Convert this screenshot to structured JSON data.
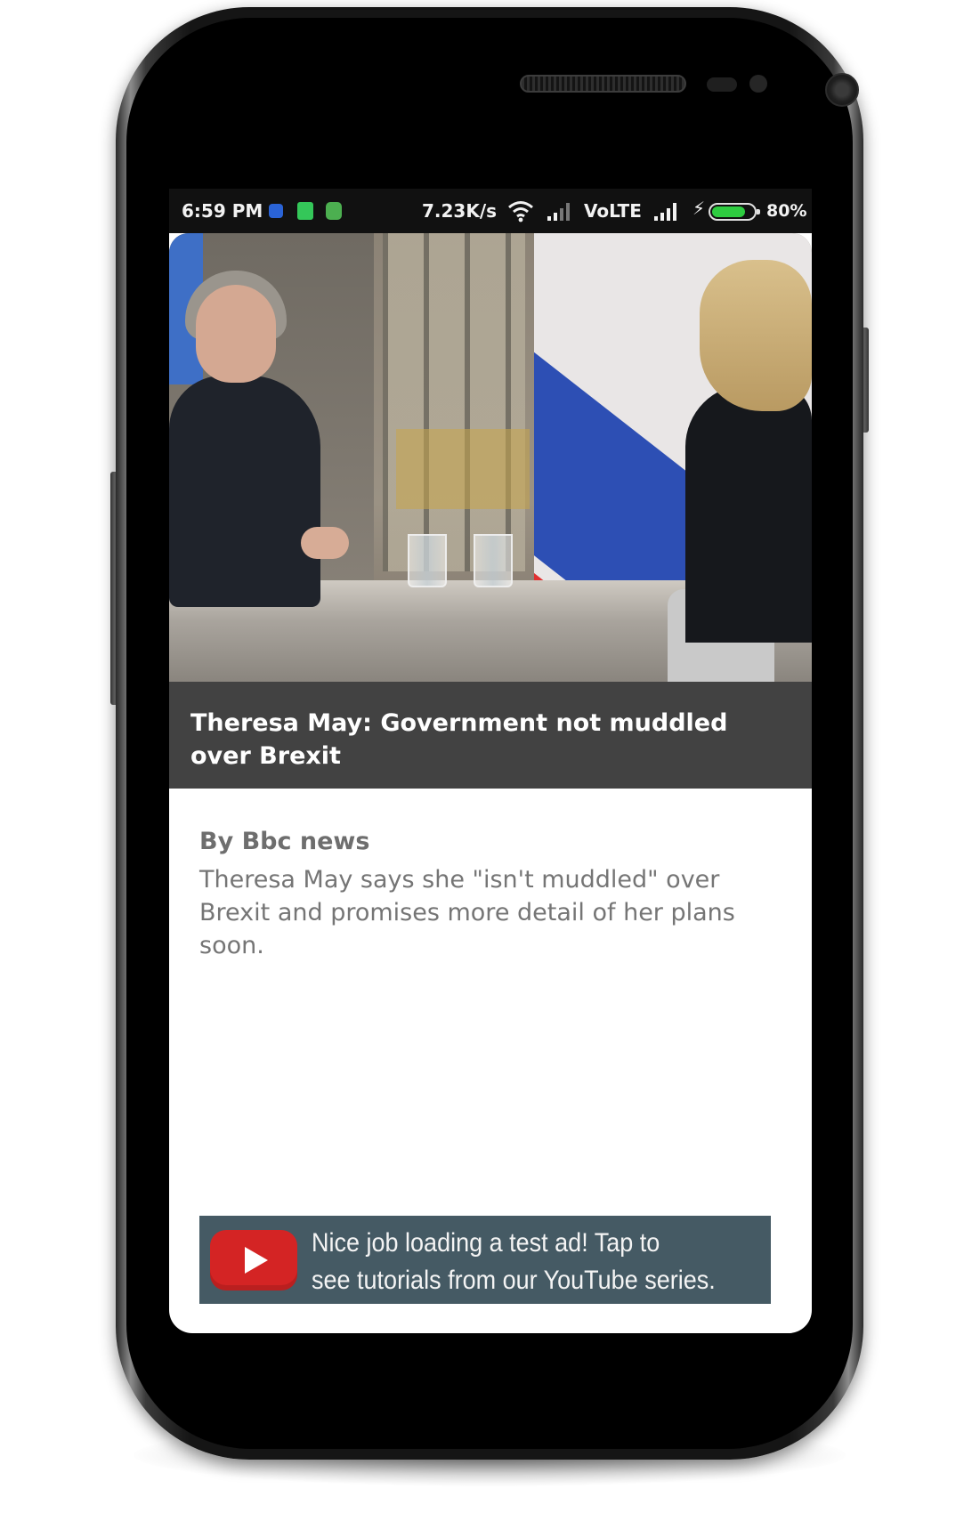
{
  "status_bar": {
    "time": "6:59 PM",
    "speed": "7.23K/s",
    "network": "VoLTE",
    "battery": "80%",
    "battery_level": 0.8,
    "icons": [
      "vpn-icon",
      "sim-card-icon",
      "android-icon",
      "wifi-icon",
      "signal-icon",
      "signal-icon",
      "charging-icon",
      "battery-icon"
    ]
  },
  "article": {
    "title": "Theresa May: Government not muddled over Brexit",
    "byline": "By Bbc news",
    "summary": "Theresa May says she \"isn't muddled\" over Brexit and promises more detail of her plans soon."
  },
  "ad": {
    "text_line1": "Nice job loading a test ad!  Tap to",
    "text_line2": "see tutorials from our YouTube series.",
    "icon": "youtube-icon",
    "background_color": "#455a64",
    "icon_color": "#d42424"
  },
  "colors": {
    "title_band": "#424242",
    "status_bar": "#111111",
    "battery_fill": "#2ecc40"
  }
}
